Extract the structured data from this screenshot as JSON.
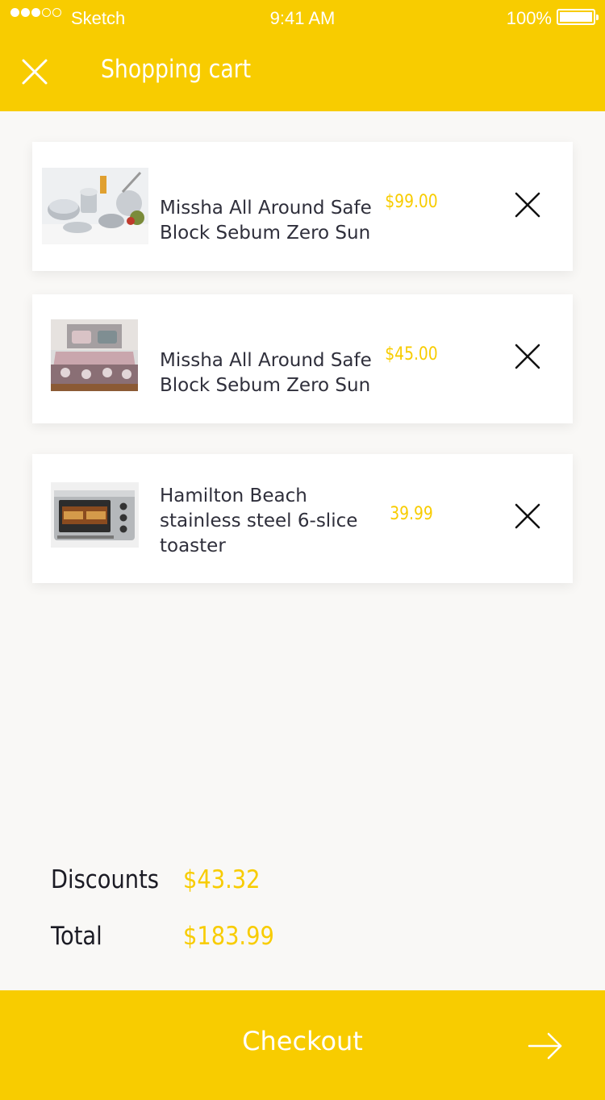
{
  "status_bar": {
    "carrier": "Sketch",
    "time": "9:41 AM",
    "battery": "100%",
    "battery_level": 1.0
  },
  "header": {
    "title": "Shopping cart",
    "close_icon": "close-icon"
  },
  "items": [
    {
      "name": "Missha All Around Safe Block Sebum Zero Sun",
      "price": "$99.00",
      "image": "cookware-set",
      "remove_icon": "close-icon"
    },
    {
      "name": "Missha All Around Safe Block Sebum Zero Sun",
      "price": "$45.00",
      "image": "bedding-set",
      "remove_icon": "close-icon"
    },
    {
      "name": "Hamilton Beach stainless steel 6-slice toaster",
      "price": "39.99",
      "image": "toaster-oven",
      "remove_icon": "close-icon"
    }
  ],
  "summary": {
    "discounts_label": "Discounts",
    "discounts_value": "$43.32",
    "total_label": "Total",
    "total_value": "$183.99"
  },
  "checkout": {
    "label": "Checkout",
    "icon": "arrow-right-icon"
  },
  "colors": {
    "accent": "#f8cc00",
    "background": "#f9f8f6",
    "text": "#2f2f3b"
  }
}
